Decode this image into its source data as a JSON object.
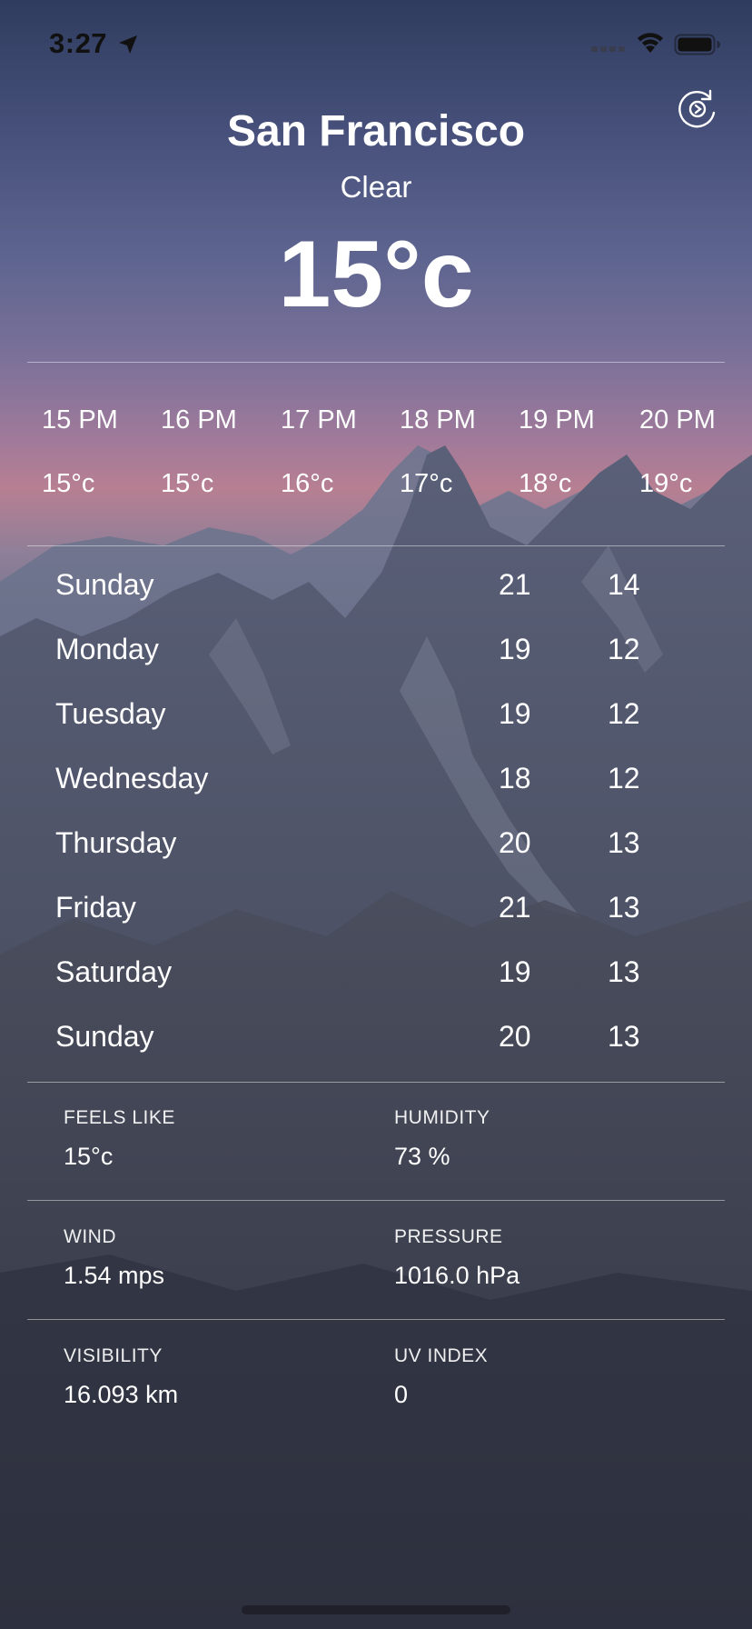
{
  "status_bar": {
    "time": "3:27",
    "icons": [
      "location-arrow-icon",
      "signal-icon",
      "wifi-icon",
      "battery-icon"
    ]
  },
  "refresh_icon": "refresh-icon",
  "header": {
    "city": "San Francisco",
    "condition": "Clear",
    "temperature": "15°c"
  },
  "hourly": [
    {
      "time": "15 PM",
      "temp": "15°c"
    },
    {
      "time": "16 PM",
      "temp": "15°c"
    },
    {
      "time": "17 PM",
      "temp": "16°c"
    },
    {
      "time": "18 PM",
      "temp": "17°c"
    },
    {
      "time": "19 PM",
      "temp": "18°c"
    },
    {
      "time": "20 PM",
      "temp": "19°c"
    }
  ],
  "daily": [
    {
      "day": "Sunday",
      "high": "21",
      "low": "14"
    },
    {
      "day": "Monday",
      "high": "19",
      "low": "12"
    },
    {
      "day": "Tuesday",
      "high": "19",
      "low": "12"
    },
    {
      "day": "Wednesday",
      "high": "18",
      "low": "12"
    },
    {
      "day": "Thursday",
      "high": "20",
      "low": "13"
    },
    {
      "day": "Friday",
      "high": "21",
      "low": "13"
    },
    {
      "day": "Saturday",
      "high": "19",
      "low": "13"
    },
    {
      "day": "Sunday",
      "high": "20",
      "low": "13"
    }
  ],
  "details": [
    {
      "left": {
        "label": "FEELS LIKE",
        "value": "15°c"
      },
      "right": {
        "label": "HUMIDITY",
        "value": "73 %"
      }
    },
    {
      "left": {
        "label": "WIND",
        "value": "1.54 mps"
      },
      "right": {
        "label": "PRESSURE",
        "value": "1016.0 hPa"
      }
    },
    {
      "left": {
        "label": "VISIBILITY",
        "value": "16.093 km"
      },
      "right": {
        "label": "UV INDEX",
        "value": "0"
      }
    }
  ]
}
